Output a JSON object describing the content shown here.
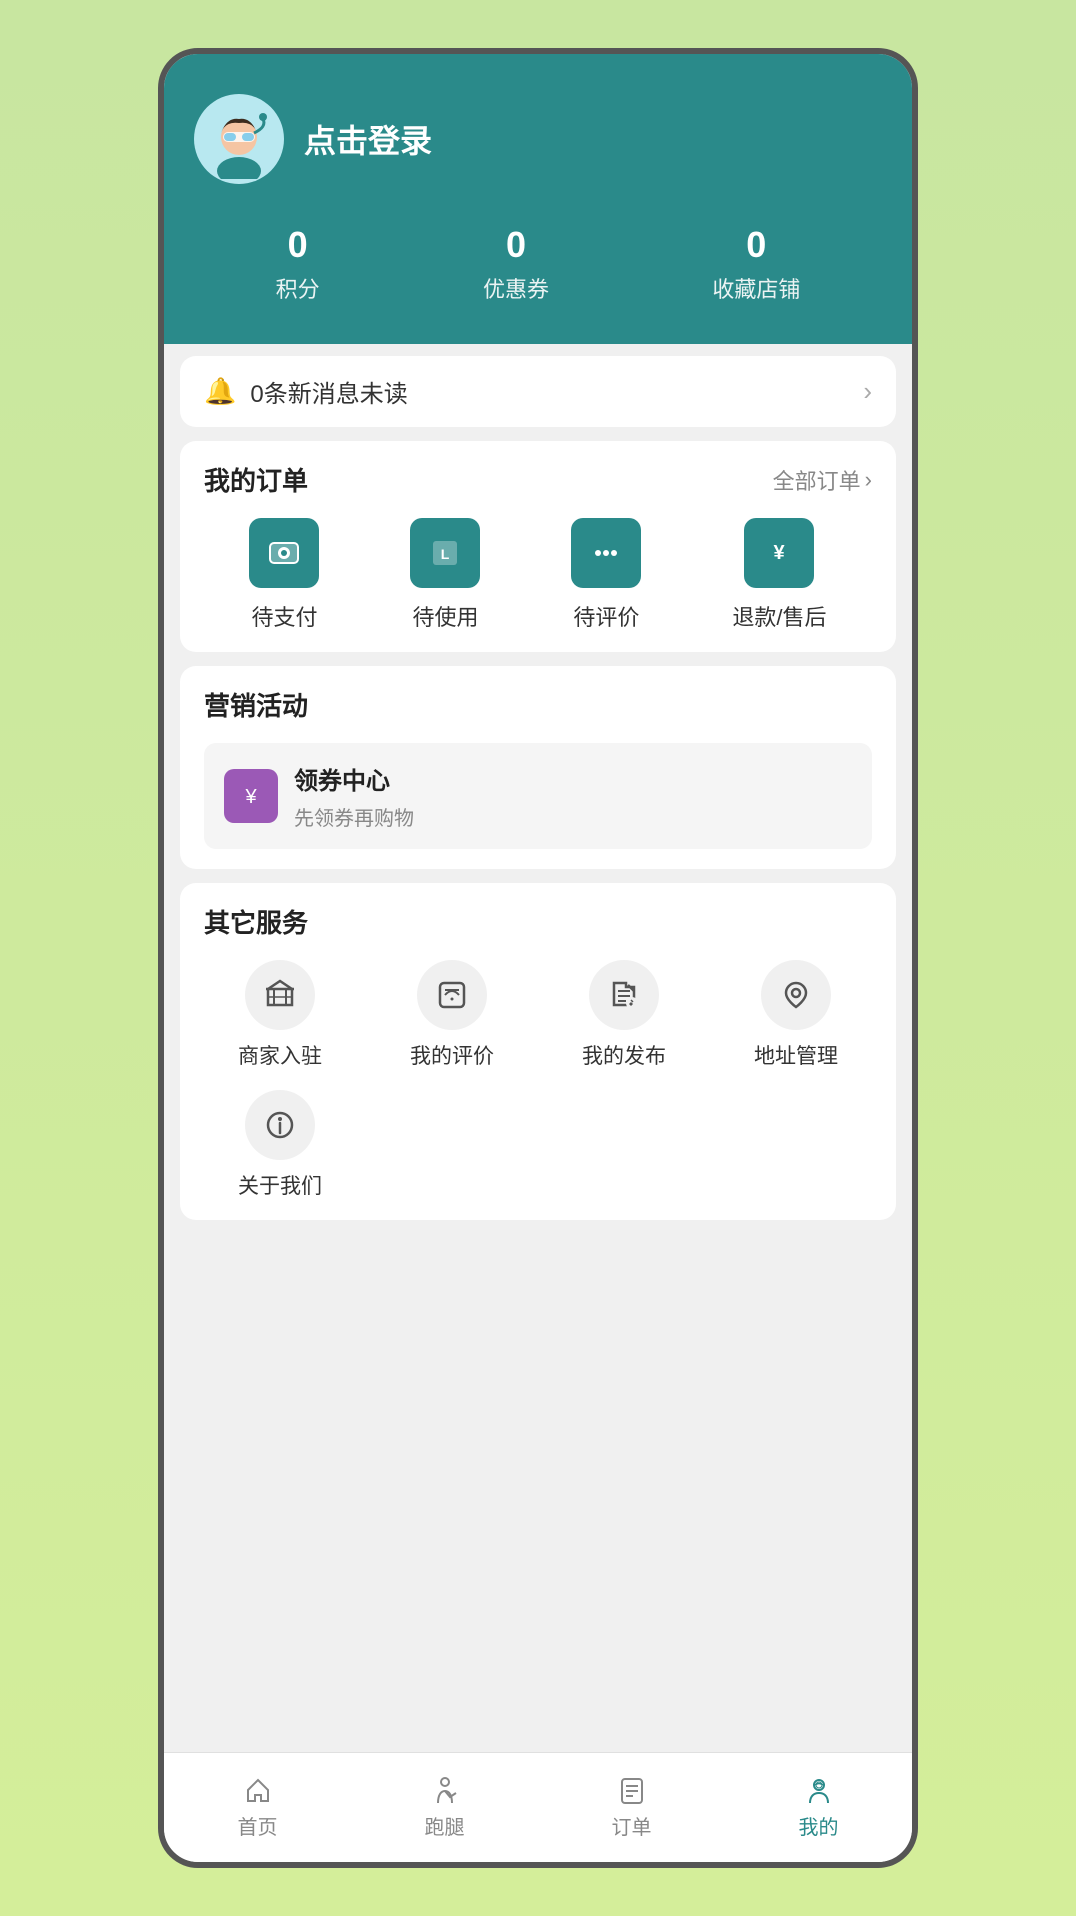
{
  "header": {
    "login_text": "点击登录",
    "stats": [
      {
        "number": "0",
        "label": "积分"
      },
      {
        "number": "0",
        "label": "优惠券"
      },
      {
        "number": "0",
        "label": "收藏店铺"
      }
    ]
  },
  "notification": {
    "text": "0条新消息未读"
  },
  "orders": {
    "title": "我的订单",
    "link": "全部订单",
    "items": [
      {
        "label": "待支付"
      },
      {
        "label": "待使用"
      },
      {
        "label": "待评价"
      },
      {
        "label": "退款/售后"
      }
    ]
  },
  "marketing": {
    "title": "营销活动",
    "coupon_center": {
      "title": "领券中心",
      "subtitle": "先领券再购物"
    }
  },
  "other_services": {
    "title": "其它服务",
    "items": [
      {
        "label": "商家入驻"
      },
      {
        "label": "我的评价"
      },
      {
        "label": "我的发布"
      },
      {
        "label": "地址管理"
      },
      {
        "label": "关于我们"
      }
    ]
  },
  "bottom_nav": {
    "items": [
      {
        "label": "首页",
        "active": false
      },
      {
        "label": "跑腿",
        "active": false
      },
      {
        "label": "订单",
        "active": false
      },
      {
        "label": "我的",
        "active": true
      }
    ]
  }
}
